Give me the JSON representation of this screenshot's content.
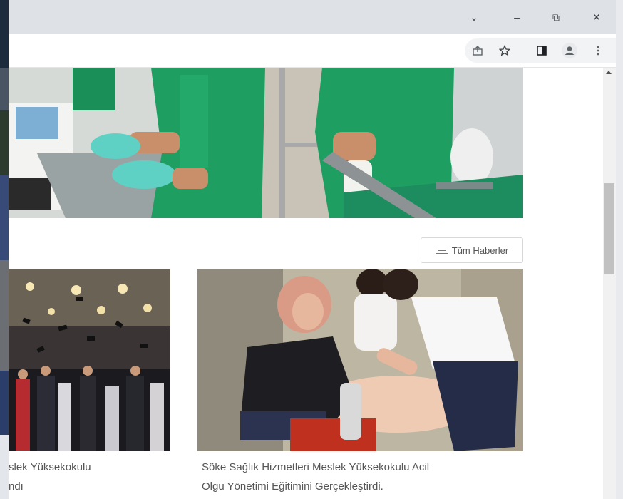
{
  "browser": {
    "window_buttons": {
      "tab_search": "⌄",
      "minimize": "–",
      "restore": "⧉",
      "close": "✕"
    },
    "toolbar_icons": [
      "share-icon",
      "bookmark-star-icon",
      "side-panel-icon",
      "profile-icon",
      "menu-icon"
    ]
  },
  "news_section": {
    "all_news_label": "Tüm Haberler",
    "cards": [
      {
        "title": "slek Yüksekokulu",
        "title_line2": "ndı",
        "image": "graduation-ceremony-photo"
      },
      {
        "title": "Söke Sağlık Hizmetleri Meslek Yüksekokulu Acil",
        "title_line2": "Olgu Yönetimi Eğitimini Gerçekleştirdi.",
        "image": "cpr-training-photo"
      }
    ]
  },
  "hero_image": "surgical-staff-photo",
  "colors": {
    "scrub_green": "#1f9e62",
    "glove_teal": "#5fd0c4",
    "text": "#555555",
    "titlebar": "#dee1e6"
  }
}
